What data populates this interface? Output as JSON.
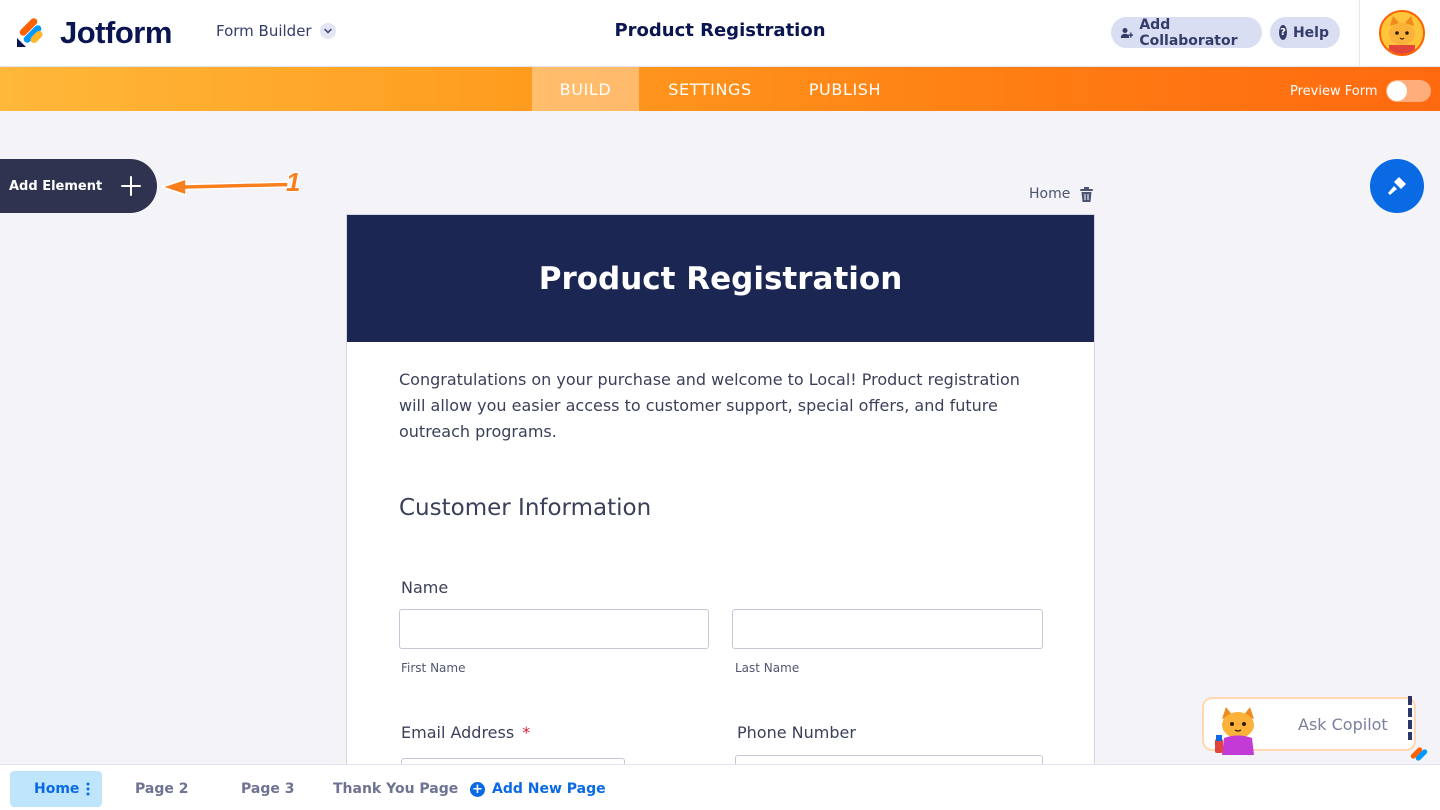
{
  "app": {
    "brand": "Jotform",
    "mode_label": "Form Builder",
    "form_title": "Product Registration",
    "add_collaborator_label": "Add Collaborator",
    "help_label": "Help"
  },
  "nav": {
    "tabs": [
      {
        "label": "BUILD",
        "active": true
      },
      {
        "label": "SETTINGS",
        "active": false
      },
      {
        "label": "PUBLISH",
        "active": false
      }
    ],
    "preview_label": "Preview Form",
    "preview_enabled": false
  },
  "sidebar": {
    "add_element_label": "Add Element",
    "annotation_number": "1"
  },
  "canvas": {
    "page_name": "Home"
  },
  "form": {
    "header_title": "Product Registration",
    "description": "Congratulations on your purchase and welcome to Local! Product registration will allow you easier access to customer support, special offers, and future outreach programs.",
    "section_title": "Customer Information",
    "fields": {
      "name_label": "Name",
      "first_name_sublabel": "First Name",
      "last_name_sublabel": "Last Name",
      "email_label": "Email Address",
      "email_required_mark": "*",
      "phone_label": "Phone Number"
    }
  },
  "pages": {
    "items": [
      {
        "label": "Home",
        "active": true
      },
      {
        "label": "Page 2",
        "active": false
      },
      {
        "label": "Page 3",
        "active": false
      },
      {
        "label": "Thank You Page",
        "active": false
      }
    ],
    "add_new_label": "Add New Page"
  },
  "copilot": {
    "label": "Ask Copilot"
  },
  "colors": {
    "brand_navy": "#0a1551",
    "orange": "#ff6100",
    "accent_blue": "#0a6ae4",
    "form_header_bg": "#1b2653"
  }
}
